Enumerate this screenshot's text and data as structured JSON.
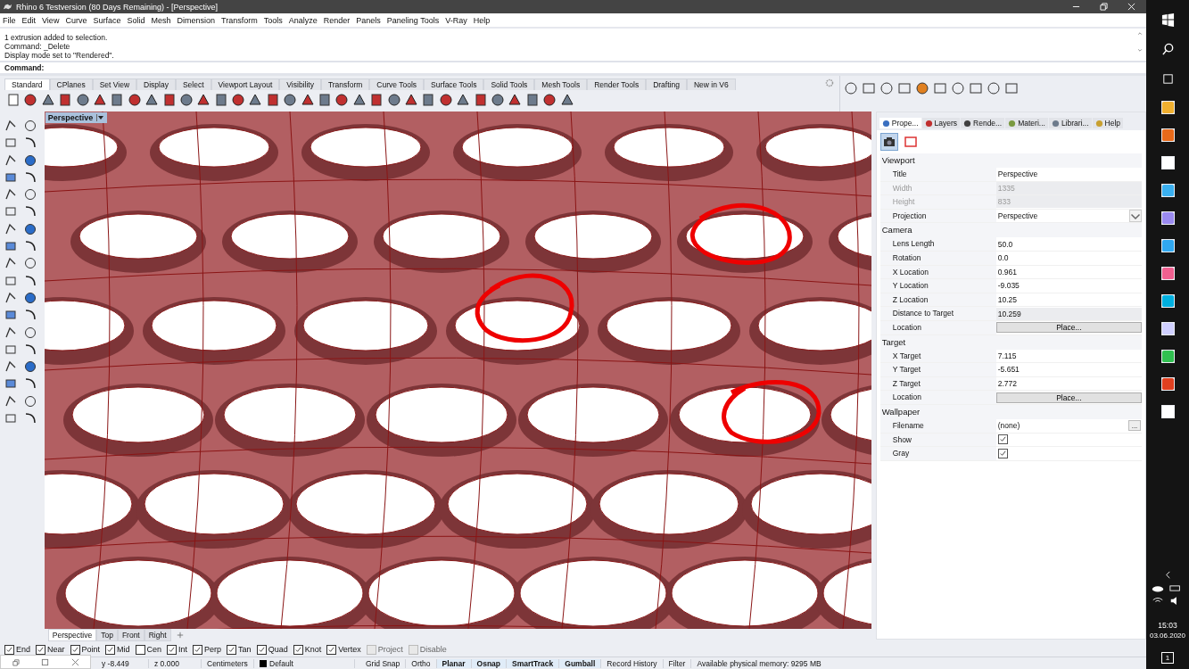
{
  "window": {
    "title": "Rhino 6 Testversion (80 Days Remaining) - [Perspective]"
  },
  "menu": [
    "File",
    "Edit",
    "View",
    "Curve",
    "Surface",
    "Solid",
    "Mesh",
    "Dimension",
    "Transform",
    "Tools",
    "Analyze",
    "Render",
    "Panels",
    "Paneling Tools",
    "V-Ray",
    "Help"
  ],
  "command_history": [
    "1 extrusion added to selection.",
    "Command: _Delete",
    "Display mode set to \"Rendered\"."
  ],
  "command_prompt": "Command:",
  "toolbar_tabs": [
    {
      "label": "Standard",
      "selected": true
    },
    {
      "label": "CPlanes",
      "selected": false
    },
    {
      "label": "Set View",
      "selected": false
    },
    {
      "label": "Display",
      "selected": false
    },
    {
      "label": "Select",
      "selected": false
    },
    {
      "label": "Viewport Layout",
      "selected": false
    },
    {
      "label": "Visibility",
      "selected": false
    },
    {
      "label": "Transform",
      "selected": false
    },
    {
      "label": "Curve Tools",
      "selected": false
    },
    {
      "label": "Surface Tools",
      "selected": false
    },
    {
      "label": "Solid Tools",
      "selected": false
    },
    {
      "label": "Mesh Tools",
      "selected": false
    },
    {
      "label": "Render Tools",
      "selected": false
    },
    {
      "label": "Drafting",
      "selected": false
    },
    {
      "label": "New in V6",
      "selected": false
    }
  ],
  "viewport": {
    "title": "Perspective"
  },
  "panel_tabs": [
    {
      "label": "Prope...",
      "selected": true
    },
    {
      "label": "Layers",
      "selected": false
    },
    {
      "label": "Rende...",
      "selected": false
    },
    {
      "label": "Materi...",
      "selected": false
    },
    {
      "label": "Librari...",
      "selected": false
    },
    {
      "label": "Help",
      "selected": false
    }
  ],
  "properties": [
    {
      "title": "Viewport",
      "rows": [
        {
          "kind": "text",
          "label": "Title",
          "value": "Perspective",
          "disabled": false
        },
        {
          "kind": "text",
          "label": "Width",
          "value": "1335",
          "disabled": true
        },
        {
          "kind": "text",
          "label": "Height",
          "value": "833",
          "disabled": true
        },
        {
          "kind": "dropdown",
          "label": "Projection",
          "value": "Perspective",
          "disabled": false
        }
      ]
    },
    {
      "title": "Camera",
      "rows": [
        {
          "kind": "text",
          "label": "Lens Length",
          "value": "50.0",
          "disabled": false
        },
        {
          "kind": "text",
          "label": "Rotation",
          "value": "0.0",
          "disabled": false
        },
        {
          "kind": "text",
          "label": "X Location",
          "value": "0.961",
          "disabled": false
        },
        {
          "kind": "text",
          "label": "Y Location",
          "value": "-9.035",
          "disabled": false
        },
        {
          "kind": "text",
          "label": "Z Location",
          "value": "10.25",
          "disabled": false
        },
        {
          "kind": "readonly",
          "label": "Distance to Target",
          "value": "10.259",
          "disabled": false
        },
        {
          "kind": "button",
          "label": "Location",
          "value": "Place...",
          "disabled": false
        }
      ]
    },
    {
      "title": "Target",
      "rows": [
        {
          "kind": "text",
          "label": "X Target",
          "value": "7.115",
          "disabled": false
        },
        {
          "kind": "text",
          "label": "Y Target",
          "value": "-5.651",
          "disabled": false
        },
        {
          "kind": "text",
          "label": "Z Target",
          "value": "2.772",
          "disabled": false
        },
        {
          "kind": "button",
          "label": "Location",
          "value": "Place...",
          "disabled": false
        }
      ]
    },
    {
      "title": "Wallpaper",
      "rows": [
        {
          "kind": "file",
          "label": "Filename",
          "value": "(none)",
          "browse": "...",
          "disabled": false
        },
        {
          "kind": "checkbox",
          "label": "Show",
          "checked": true,
          "disabled": false
        },
        {
          "kind": "checkbox",
          "label": "Gray",
          "checked": true,
          "disabled": false
        }
      ]
    }
  ],
  "viewport_tabs": [
    {
      "label": "Perspective",
      "selected": true
    },
    {
      "label": "Top",
      "selected": false
    },
    {
      "label": "Front",
      "selected": false
    },
    {
      "label": "Right",
      "selected": false
    }
  ],
  "osnaps": [
    {
      "label": "End",
      "checked": true,
      "disabled": false
    },
    {
      "label": "Near",
      "checked": true,
      "disabled": false
    },
    {
      "label": "Point",
      "checked": true,
      "disabled": false
    },
    {
      "label": "Mid",
      "checked": true,
      "disabled": false
    },
    {
      "label": "Cen",
      "checked": false,
      "disabled": false
    },
    {
      "label": "Int",
      "checked": true,
      "disabled": false
    },
    {
      "label": "Perp",
      "checked": true,
      "disabled": false
    },
    {
      "label": "Tan",
      "checked": true,
      "disabled": false
    },
    {
      "label": "Quad",
      "checked": true,
      "disabled": false
    },
    {
      "label": "Knot",
      "checked": true,
      "disabled": false
    },
    {
      "label": "Vertex",
      "checked": true,
      "disabled": false
    },
    {
      "label": "Project",
      "checked": false,
      "disabled": true
    },
    {
      "label": "Disable",
      "checked": false,
      "disabled": true
    }
  ],
  "status_bar": {
    "coordinates": [
      "y -8.449",
      "z 0.000"
    ],
    "units": "Centimeters",
    "layer": "Default",
    "toggles": [
      {
        "label": "Grid Snap",
        "on": false
      },
      {
        "label": "Ortho",
        "on": false
      },
      {
        "label": "Planar",
        "on": true
      },
      {
        "label": "Osnap",
        "on": true
      },
      {
        "label": "SmartTrack",
        "on": true
      },
      {
        "label": "Gumball",
        "on": true
      },
      {
        "label": "Record History",
        "on": false
      },
      {
        "label": "Filter",
        "on": false
      }
    ],
    "memory": "Available physical memory: 9295 MB"
  },
  "taskbar": {
    "time": "15:03",
    "date": "03.06.2020",
    "notifications": "1"
  }
}
